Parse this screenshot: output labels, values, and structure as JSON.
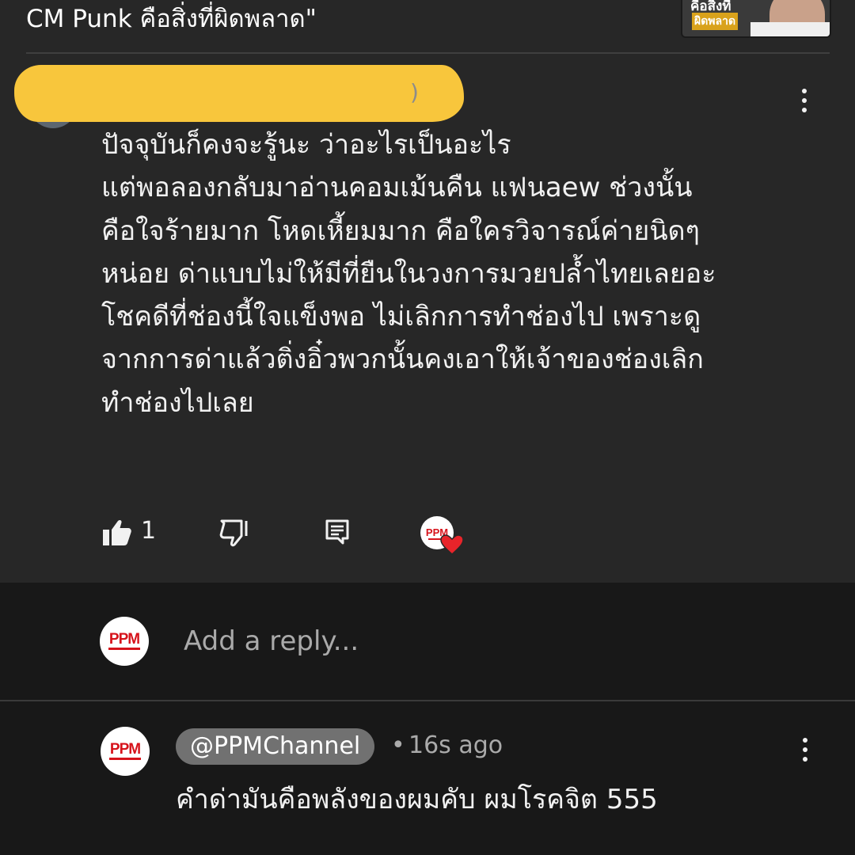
{
  "header": {
    "video_title": "CM Punk คือสิ่งที่ผิดพลาด\"",
    "thumbnail": {
      "line1": "คือสิ่งที่",
      "line2": "ผิดพลาด"
    }
  },
  "main_comment": {
    "author_tail": ")",
    "body_lines": [
      "ปัจจุบันก็คงจะรู้นะ ว่าอะไรเป็นอะไร",
      "แต่พอลองกลับมาอ่านคอมเม้นคืน แฟนaew ช่วงนั้น",
      "คือใจร้ายมาก โหดเหี้ยมมาก คือใครวิจารณ์ค่ายนิดๆ",
      "หน่อย ด่าแบบไม่ให้มีที่ยืนในวงการมวยปล้ำไทยเลยอะ",
      "โชคดีที่ช่องนี้ใจแข็งพอ ไม่เลิกการทำช่องไป เพราะดู",
      "จากการด่าแล้วติ่งอิ๋วพวกนั้นคงเอาให้เจ้าของช่องเลิก",
      "ทำช่องไปเลย"
    ],
    "like_count": "1",
    "icons": {
      "like": "thumb-up-filled-icon",
      "dislike": "thumb-down-icon",
      "reply": "reply-comment-icon",
      "creator_heart": "creator-heart-icon",
      "more": "more-vert-icon"
    }
  },
  "composer": {
    "avatar_text": "PPM",
    "placeholder": "Add a reply..."
  },
  "reply": {
    "avatar_text": "PPM",
    "author": "@PPMChannel",
    "separator": "•",
    "time": "16s ago",
    "text": "คำด่ามันคือพลังของผมคับ ผมโรคจิต 555"
  },
  "colors": {
    "background": "#272727",
    "composer_background": "#181818",
    "redaction": "#f8c63c",
    "brand_red": "#d6131b",
    "heart": "#e8242a",
    "author_chip": "#717171",
    "secondary_text": "#aaaaaa"
  }
}
